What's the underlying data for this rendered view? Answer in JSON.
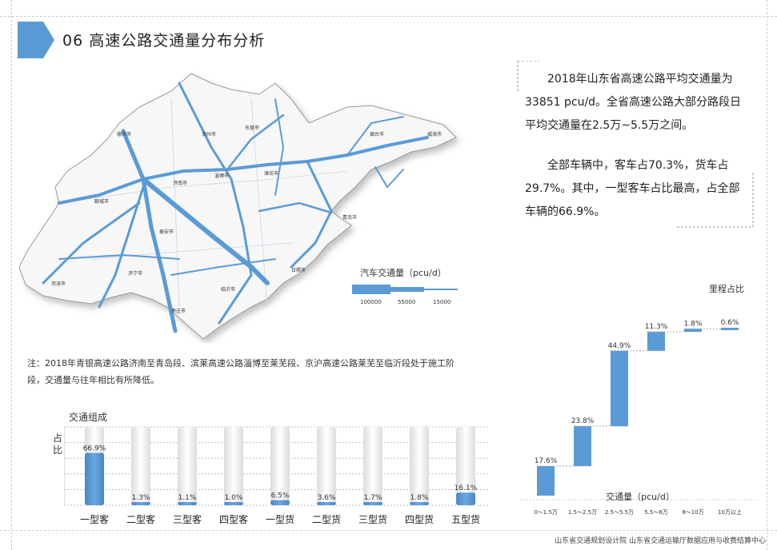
{
  "header": {
    "title": "06  高速公路交通量分布分析"
  },
  "map": {
    "cities": [
      "德州市",
      "滨州市",
      "东营市",
      "烟台市",
      "威海市",
      "济南市",
      "淄博市",
      "潍坊市",
      "聊城市",
      "青岛市",
      "泰安市",
      "日照市",
      "济宁市",
      "临沂市",
      "菏泽市",
      "枣庄市"
    ],
    "legend_title": "汽车交通量（pcu/d）",
    "legend_values": [
      "100000",
      "55000",
      "15000"
    ]
  },
  "note": "注：2018年青银高速公路济南至青岛段、滨莱高速公路淄博至莱芜段、京沪高速公路莱芜至临沂段处于施工阶段，交通量与往年相比有所降低。",
  "description": {
    "p1": "2018年山东省高速公路平均交通量为33851 pcu/d。全省高速公路大部分路段日平均交通量在2.5万~5.5万之间。",
    "p2": "全部车辆中，客车占70.3%，货车占29.7%。其中，一型客车占比最高，占全部车辆的66.9%。"
  },
  "footer": "山东省交通规划设计院   山东省交通运输厅数据应用与收费结算中心",
  "chart_data": [
    {
      "type": "bar",
      "title": "交通组成",
      "ylabel": "占比",
      "categories": [
        "一型客",
        "二型客",
        "三型客",
        "四型客",
        "一型货",
        "二型货",
        "三型货",
        "四型货",
        "五型货"
      ],
      "values": [
        66.9,
        1.3,
        1.1,
        1.0,
        6.5,
        3.6,
        1.7,
        1.8,
        16.1
      ],
      "value_labels": [
        "66.9%",
        "1.3%",
        "1.1%",
        "1.0%",
        "6.5%",
        "3.6%",
        "1.7%",
        "1.8%",
        "16.1%"
      ],
      "ylim": [
        0,
        100
      ],
      "grid": true
    },
    {
      "type": "bar",
      "subtype": "waterfall",
      "title": "里程占比",
      "xlabel": "交通量（pcu/d）",
      "categories": [
        "0～1.5万",
        "1.5～2.5万",
        "2.5～5.5万",
        "5.5～8万",
        "8～10万",
        "10万以上"
      ],
      "values": [
        17.6,
        23.8,
        44.9,
        11.3,
        1.8,
        0.6
      ],
      "value_labels": [
        "17.6%",
        "23.8%",
        "44.9%",
        "11.3%",
        "1.8%",
        "0.6%"
      ],
      "ylim": [
        0,
        100
      ]
    }
  ],
  "colors": {
    "accent": "#5b9bd5",
    "bar_bg": "#e6e6e6",
    "tab": "#5b9bd5"
  }
}
